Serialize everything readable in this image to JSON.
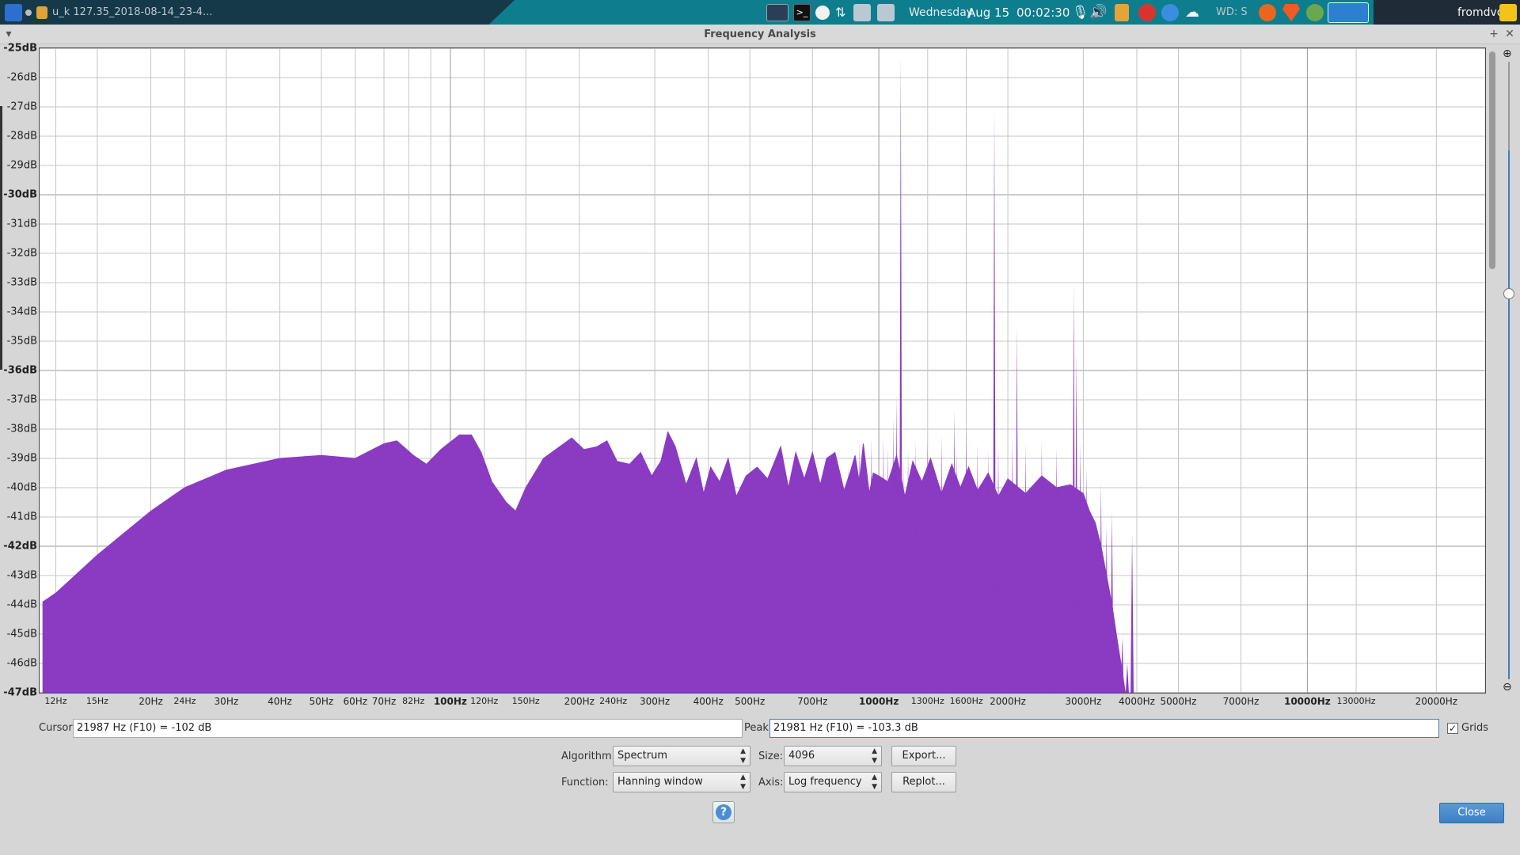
{
  "taskbar": {
    "task_title": "u_k 127.35_2018-08-14_23-4...",
    "day": "Wednesday",
    "date": "Aug 15",
    "time": "00:02:30",
    "weather": "WD: S",
    "user": "fromdvd"
  },
  "window": {
    "title": "Frequency Analysis",
    "menu_glyph": "▾",
    "pin_glyph": "+",
    "close_glyph": "✕"
  },
  "chart_data": {
    "type": "area",
    "title": "",
    "xlabel": "",
    "ylabel": "",
    "x_scale": "log",
    "xlim": [
      11,
      26000
    ],
    "ylim": [
      -47,
      -25
    ],
    "grid": true,
    "color": "#8a3bc2",
    "y_ticks": [
      "-25dB",
      "-26dB",
      "-27dB",
      "-28dB",
      "-29dB",
      "-30dB",
      "-31dB",
      "-32dB",
      "-33dB",
      "-34dB",
      "-35dB",
      "-36dB",
      "-37dB",
      "-38dB",
      "-39dB",
      "-40dB",
      "-41dB",
      "-42dB",
      "-43dB",
      "-44dB",
      "-45dB",
      "-46dB",
      "-47dB"
    ],
    "y_bold_ticks": [
      "-25dB",
      "-30dB",
      "-36dB",
      "-42dB",
      "-47dB"
    ],
    "x_ticks": [
      {
        "f": 12,
        "label": "12Hz",
        "style": "small"
      },
      {
        "f": 15,
        "label": "15Hz",
        "style": "small"
      },
      {
        "f": 20,
        "label": "20Hz",
        "style": ""
      },
      {
        "f": 24,
        "label": "24Hz",
        "style": "small"
      },
      {
        "f": 30,
        "label": "30Hz",
        "style": ""
      },
      {
        "f": 40,
        "label": "40Hz",
        "style": ""
      },
      {
        "f": 50,
        "label": "50Hz",
        "style": ""
      },
      {
        "f": 60,
        "label": "60Hz",
        "style": ""
      },
      {
        "f": 70,
        "label": "70Hz",
        "style": ""
      },
      {
        "f": 82,
        "label": "82Hz",
        "style": "small"
      },
      {
        "f": 100,
        "label": "100Hz",
        "style": "bold"
      },
      {
        "f": 120,
        "label": "120Hz",
        "style": "small"
      },
      {
        "f": 150,
        "label": "150Hz",
        "style": "small"
      },
      {
        "f": 200,
        "label": "200Hz",
        "style": ""
      },
      {
        "f": 240,
        "label": "240Hz",
        "style": "small"
      },
      {
        "f": 300,
        "label": "300Hz",
        "style": ""
      },
      {
        "f": 400,
        "label": "400Hz",
        "style": ""
      },
      {
        "f": 500,
        "label": "500Hz",
        "style": ""
      },
      {
        "f": 700,
        "label": "700Hz",
        "style": ""
      },
      {
        "f": 1000,
        "label": "1000Hz",
        "style": "bold"
      },
      {
        "f": 1300,
        "label": "1300Hz",
        "style": "small"
      },
      {
        "f": 1600,
        "label": "1600Hz",
        "style": "small"
      },
      {
        "f": 2000,
        "label": "2000Hz",
        "style": ""
      },
      {
        "f": 3000,
        "label": "3000Hz",
        "style": ""
      },
      {
        "f": 4000,
        "label": "4000Hz",
        "style": ""
      },
      {
        "f": 5000,
        "label": "5000Hz",
        "style": ""
      },
      {
        "f": 7000,
        "label": "7000Hz",
        "style": ""
      },
      {
        "f": 10000,
        "label": "10000Hz",
        "style": "bold"
      },
      {
        "f": 13000,
        "label": "13000Hz",
        "style": "small"
      },
      {
        "f": 20000,
        "label": "20000Hz",
        "style": ""
      }
    ],
    "x_grid": [
      12,
      15,
      20,
      24,
      30,
      40,
      50,
      60,
      70,
      80,
      90,
      100,
      120,
      150,
      200,
      300,
      400,
      500,
      700,
      1000,
      1300,
      1600,
      2000,
      3000,
      4000,
      5000,
      7000,
      10000,
      13000,
      20000
    ],
    "envelope": [
      [
        11.2,
        -43.9
      ],
      [
        12,
        -43.6
      ],
      [
        15,
        -42.3
      ],
      [
        20,
        -40.8
      ],
      [
        24,
        -40.0
      ],
      [
        30,
        -39.4
      ],
      [
        40,
        -39.0
      ],
      [
        50,
        -38.9
      ],
      [
        60,
        -39.0
      ],
      [
        70,
        -38.5
      ],
      [
        75,
        -38.4
      ],
      [
        82,
        -38.9
      ],
      [
        88,
        -39.2
      ],
      [
        95,
        -38.7
      ],
      [
        105,
        -38.2
      ],
      [
        112,
        -38.2
      ],
      [
        118,
        -38.8
      ],
      [
        125,
        -39.8
      ],
      [
        135,
        -40.5
      ],
      [
        142,
        -40.8
      ],
      [
        150,
        -40.0
      ],
      [
        165,
        -39.0
      ],
      [
        180,
        -38.6
      ],
      [
        192,
        -38.3
      ],
      [
        205,
        -38.7
      ],
      [
        220,
        -38.6
      ],
      [
        232,
        -38.4
      ],
      [
        245,
        -39.1
      ],
      [
        262,
        -39.2
      ],
      [
        278,
        -38.8
      ],
      [
        295,
        -39.6
      ],
      [
        310,
        -39.1
      ],
      [
        322,
        -38.1
      ],
      [
        335,
        -38.6
      ],
      [
        355,
        -39.9
      ],
      [
        375,
        -39.0
      ],
      [
        390,
        -40.2
      ],
      [
        405,
        -39.3
      ],
      [
        425,
        -39.8
      ],
      [
        445,
        -39.0
      ],
      [
        465,
        -40.3
      ],
      [
        490,
        -39.6
      ],
      [
        520,
        -39.3
      ],
      [
        550,
        -39.7
      ],
      [
        590,
        -38.6
      ],
      [
        615,
        -40.0
      ],
      [
        640,
        -38.8
      ],
      [
        670,
        -39.7
      ],
      [
        700,
        -38.8
      ],
      [
        730,
        -39.9
      ],
      [
        755,
        -39.0
      ],
      [
        790,
        -38.8
      ],
      [
        830,
        -40.1
      ],
      [
        860,
        -39.4
      ],
      [
        880,
        -38.9
      ],
      [
        900,
        -39.8
      ],
      [
        920,
        -38.5
      ],
      [
        950,
        -40.2
      ],
      [
        970,
        -39.5
      ],
      [
        1000,
        -39.6
      ],
      [
        1050,
        -39.8
      ],
      [
        1100,
        -38.9
      ],
      [
        1150,
        -40.3
      ],
      [
        1200,
        -39.1
      ],
      [
        1260,
        -39.8
      ],
      [
        1320,
        -39.0
      ],
      [
        1400,
        -40.2
      ],
      [
        1480,
        -39.2
      ],
      [
        1550,
        -40.0
      ],
      [
        1620,
        -39.3
      ],
      [
        1700,
        -40.1
      ],
      [
        1800,
        -39.5
      ],
      [
        1900,
        -40.3
      ],
      [
        2000,
        -39.7
      ],
      [
        2200,
        -40.2
      ],
      [
        2400,
        -39.6
      ],
      [
        2600,
        -40.0
      ],
      [
        2800,
        -39.9
      ],
      [
        3000,
        -40.2
      ],
      [
        3100,
        -40.8
      ],
      [
        3200,
        -41.2
      ],
      [
        3300,
        -42.0
      ],
      [
        3400,
        -43.0
      ],
      [
        3500,
        -44.0
      ],
      [
        3600,
        -45.2
      ],
      [
        3700,
        -46.3
      ],
      [
        3760,
        -47.0
      ]
    ],
    "peaks": [
      [
        850,
        -39.2
      ],
      [
        900,
        -38.4
      ],
      [
        960,
        -38.3
      ],
      [
        1000,
        -40.6
      ],
      [
        1025,
        -38.2
      ],
      [
        1050,
        -38.5
      ],
      [
        1080,
        -37.6
      ],
      [
        1100,
        -36.8
      ],
      [
        1125,
        -25.3
      ],
      [
        1140,
        -38.9
      ],
      [
        1170,
        -38.7
      ],
      [
        1220,
        -38.4
      ],
      [
        1300,
        -38.3
      ],
      [
        1400,
        -38.2
      ],
      [
        1500,
        -37.3
      ],
      [
        1520,
        -38.7
      ],
      [
        1600,
        -38.0
      ],
      [
        1700,
        -38.5
      ],
      [
        1800,
        -38.7
      ],
      [
        1860,
        -27.1
      ],
      [
        1900,
        -38.6
      ],
      [
        2050,
        -38.3
      ],
      [
        2100,
        -34.4
      ],
      [
        2200,
        -38.5
      ],
      [
        2400,
        -38.4
      ],
      [
        2600,
        -38.6
      ],
      [
        2850,
        -33.1
      ],
      [
        2890,
        -35.4
      ],
      [
        2950,
        -38.5
      ],
      [
        3050,
        -39.3
      ],
      [
        3300,
        -39.8
      ],
      [
        3400,
        -41.3
      ],
      [
        3500,
        -40.8
      ],
      [
        3700,
        -45.1
      ],
      [
        3800,
        -46.0
      ],
      [
        3900,
        -41.6
      ]
    ]
  },
  "controls": {
    "cursor_label": "Cursor:",
    "cursor_value": "21987 Hz (F10) = -102 dB",
    "peak_label": "Peak:",
    "peak_value": "21981 Hz (F10) = -103.3 dB",
    "grids_checked": "✓",
    "grids_label": "Grids",
    "algorithm_label": "Algorithm:",
    "algorithm_value": "Spectrum",
    "size_label": "Size:",
    "size_value": "4096",
    "function_label": "Function:",
    "function_value": "Hanning window",
    "axis_label": "Axis:",
    "axis_value": "Log frequency",
    "export_label": "Export...",
    "replot_label": "Replot...",
    "help_glyph": "?",
    "close_label": "Close"
  },
  "colors": {
    "spectrum": "#8a3bc2",
    "grid": "#c4c4c4",
    "grid_major": "#9a9a9a",
    "panel": "#0e7d8e",
    "accent": "#3d7dc4"
  }
}
